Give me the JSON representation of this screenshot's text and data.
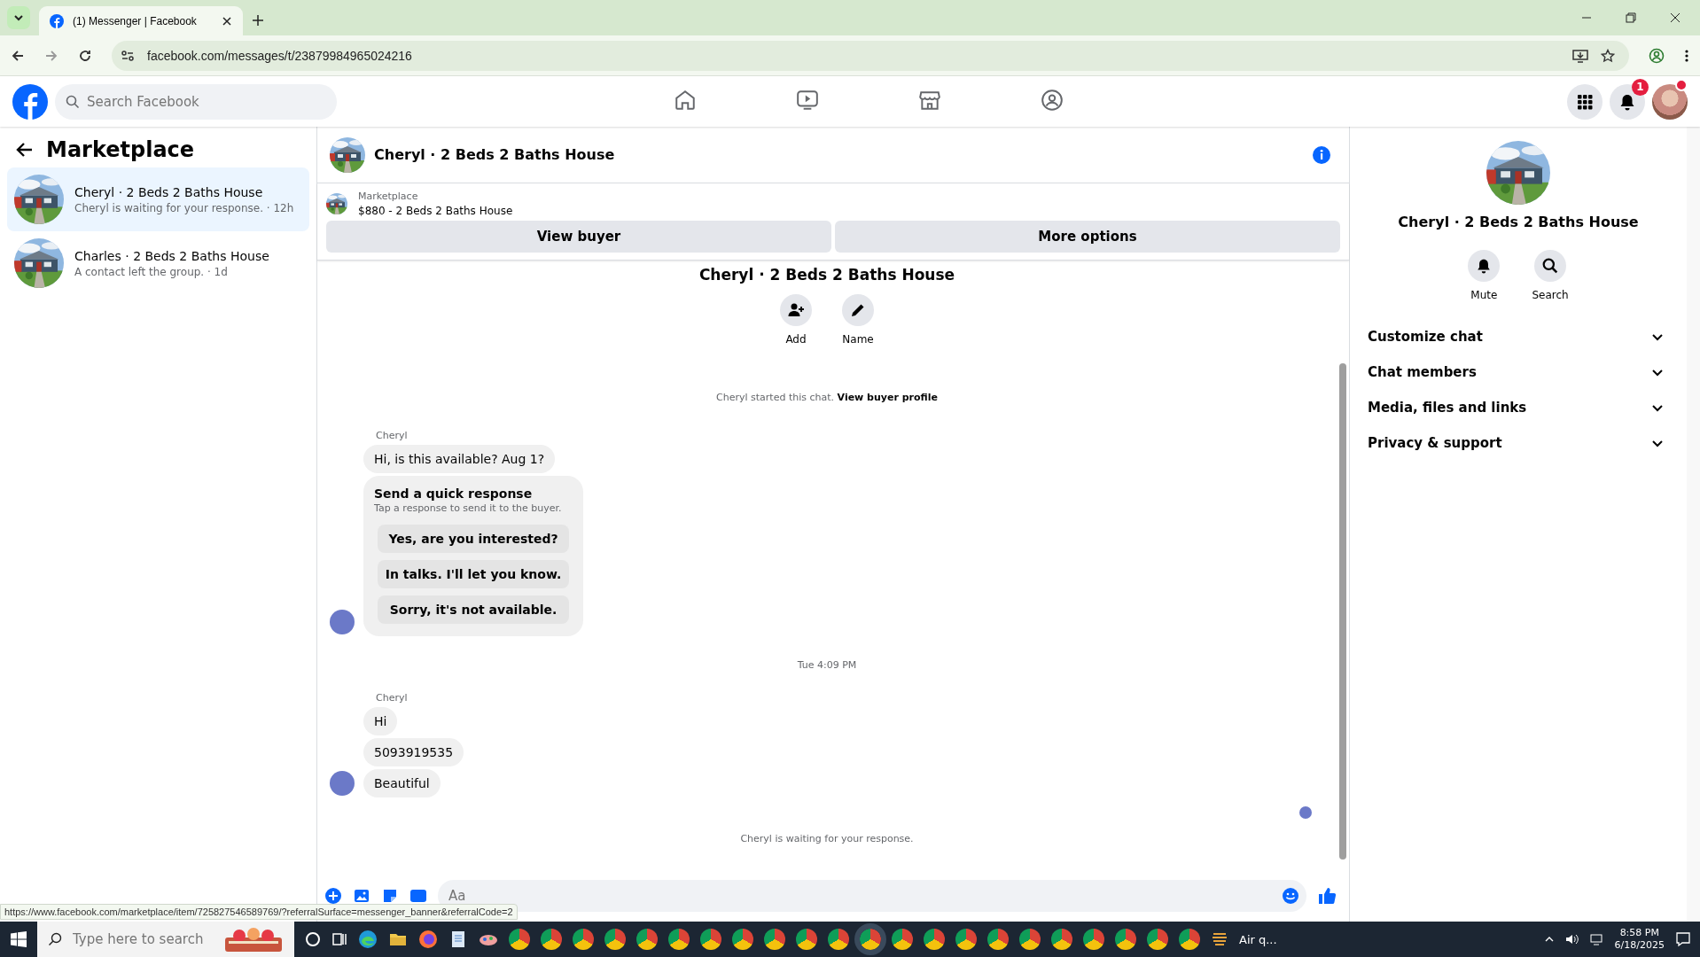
{
  "browser": {
    "tab_title": "(1) Messenger | Facebook",
    "url": "facebook.com/messages/t/23879984965024216",
    "status_url": "https://www.facebook.com/marketplace/item/725827546589769/?referralSurface=messenger_banner&referralCode=2"
  },
  "topnav": {
    "search_placeholder": "Search Facebook",
    "nav": [
      {
        "kind": "home",
        "selected": false
      },
      {
        "kind": "video",
        "selected": false
      },
      {
        "kind": "store",
        "selected": false
      },
      {
        "kind": "groups",
        "selected": false
      }
    ],
    "notification_count": "1"
  },
  "sidebar": {
    "title": "Marketplace",
    "items": [
      {
        "name": "Cheryl · 2 Beds 2 Baths House",
        "preview": "Cheryl is waiting for your response. · 12h",
        "selected": true
      },
      {
        "name": "Charles · 2 Beds 2 Baths House",
        "preview": "A contact left the group. · 1d",
        "selected": false
      }
    ]
  },
  "chat": {
    "title": "Cheryl · 2 Beds 2 Baths House",
    "banner": {
      "label": "Marketplace",
      "listing": "$880 - 2 Beds 2 Baths House",
      "buttons": [
        "View buyer",
        "More options"
      ]
    },
    "intro": {
      "title": "Cheryl · 2 Beds 2 Baths House",
      "actions": [
        {
          "kind": "add",
          "label": "Add"
        },
        {
          "kind": "name",
          "label": "Name"
        }
      ],
      "started": "Cheryl started this chat.",
      "link": "View buyer profile"
    },
    "groups": [
      {
        "sender": "Cheryl",
        "messages": [
          "Hi, is this available? Aug 1?"
        ],
        "quick": {
          "title": "Send a quick response",
          "hint": "Tap a response to send it to the buyer.",
          "options": [
            "Yes, are you interested?",
            "In talks. I'll let you know.",
            "Sorry, it's not available."
          ]
        }
      },
      {
        "time": "Tue 4:09 PM",
        "sender": "Cheryl",
        "messages": [
          "Hi",
          "5093919535",
          "Beautiful"
        ]
      }
    ],
    "footer": "Cheryl is waiting for your response.",
    "composer_placeholder": "Aa"
  },
  "info": {
    "title": "Cheryl · 2 Beds 2 Baths House",
    "actions": [
      {
        "kind": "mute",
        "label": "Mute"
      },
      {
        "kind": "search",
        "label": "Search"
      }
    ],
    "sections": [
      {
        "label": "Customize chat",
        "expanded": false
      },
      {
        "label": "Chat members",
        "expanded": false
      },
      {
        "label": "Media, files and links",
        "expanded": false
      },
      {
        "label": "Privacy & support",
        "expanded": false
      }
    ]
  },
  "taskbar": {
    "search_placeholder": "Type here to search",
    "weather": "Air q...",
    "time": "8:58 PM",
    "date": "6/18/2025"
  }
}
